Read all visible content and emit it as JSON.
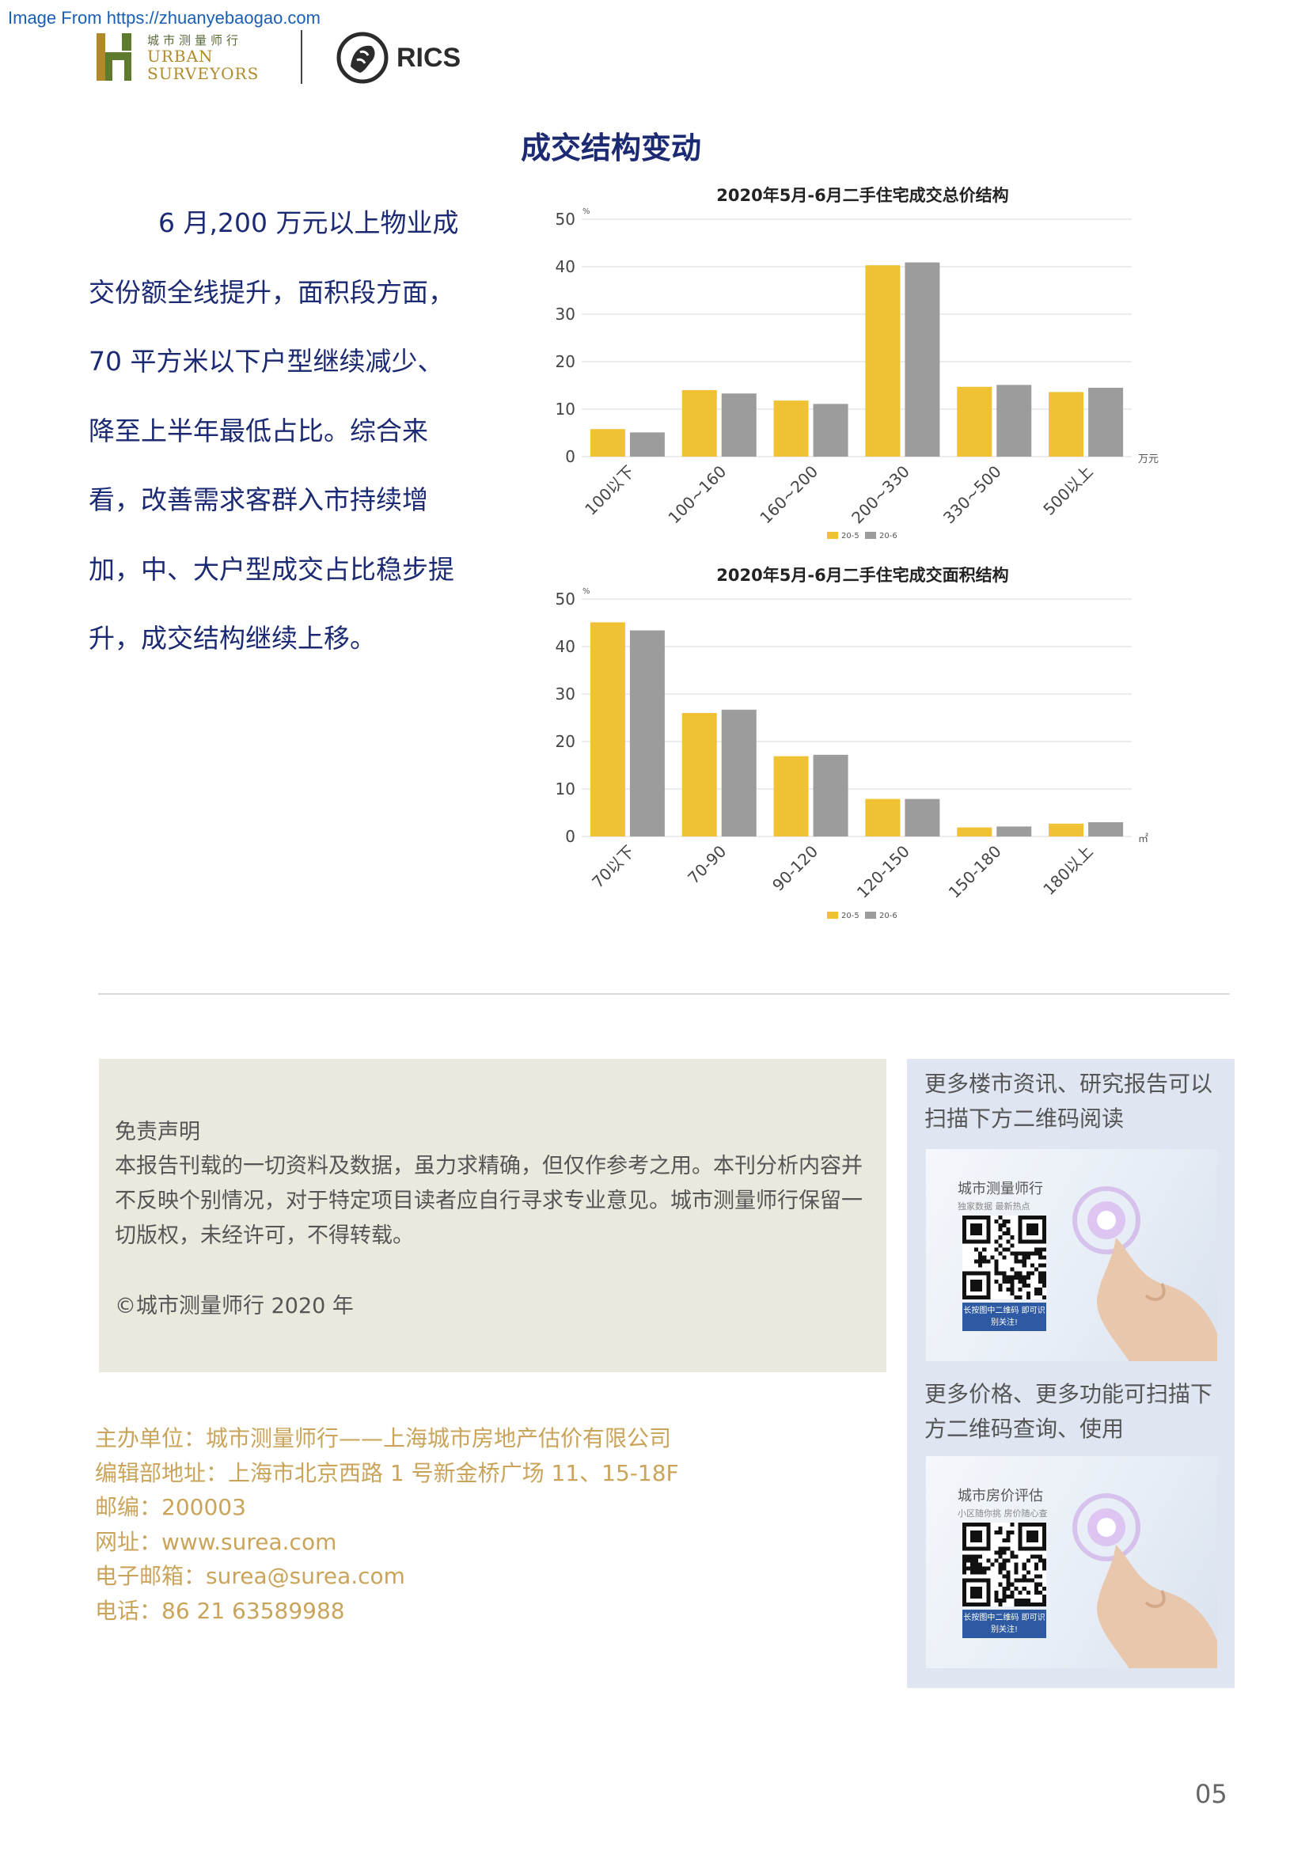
{
  "source_link": "Image From https://zhuanyebaogao.com",
  "header": {
    "logo_cn": "城市测量师行",
    "logo_en_line1": "URBAN",
    "logo_en_line2": "SURVEYORS",
    "rics": "RICS"
  },
  "page_title": "成交结构变动",
  "body_paragraph": "6 月,200 万元以上物业成交份额全线提升，面积段方面，70 平方米以下户型继续减少、降至上半年最低占比。综合来看，改善需求客群入市持续增加，中、大户型成交占比稳步提升，成交结构继续上移。",
  "body_lines": [
    "6 月,200 万元以上物业成",
    "交份额全线提升，面积段方面，",
    "70  平方米以下户型继续减少、",
    "降至上半年最低占比。综合来",
    "看，改善需求客群入市持续增",
    "加，中、大户型成交占比稳步提",
    "升，成交结构继续上移。"
  ],
  "chart_data": [
    {
      "type": "bar",
      "title": "2020年5月-6月二手住宅成交总价结构",
      "ylabel": "%",
      "xlabel": "万元",
      "ylim": [
        0,
        50
      ],
      "yticks": [
        0,
        10,
        20,
        30,
        40,
        50
      ],
      "categories": [
        "100以下",
        "100~160",
        "160~200",
        "200~330",
        "330~500",
        "500以上"
      ],
      "series": [
        {
          "name": "20-5",
          "color": "#f0c132",
          "values": [
            5.8,
            14.0,
            11.8,
            40.3,
            14.7,
            13.6
          ]
        },
        {
          "name": "20-6",
          "color": "#9c9c9c",
          "values": [
            5.1,
            13.3,
            11.1,
            40.9,
            15.1,
            14.5
          ]
        }
      ],
      "grid": true,
      "legend": "bottom"
    },
    {
      "type": "bar",
      "title": "2020年5月-6月二手住宅成交面积结构",
      "ylabel": "%",
      "xlabel": "㎡",
      "ylim": [
        0,
        50
      ],
      "yticks": [
        0,
        10,
        20,
        30,
        40,
        50
      ],
      "categories": [
        "70以下",
        "70-90",
        "90-120",
        "120-150",
        "150-180",
        "180以上"
      ],
      "series": [
        {
          "name": "20-5",
          "color": "#f0c132",
          "values": [
            45.1,
            26.0,
            16.9,
            7.9,
            1.9,
            2.7
          ]
        },
        {
          "name": "20-6",
          "color": "#9c9c9c",
          "values": [
            43.4,
            26.7,
            17.2,
            7.9,
            2.1,
            3.0
          ]
        }
      ],
      "grid": true,
      "legend": "bottom"
    }
  ],
  "disclaimer": {
    "title": "免责声明",
    "text": "本报告刊载的一切资料及数据，虽力求精确，但仅作参考之用。本刊分析内容并不反映个别情况，对于特定项目读者应自行寻求专业意见。城市测量师行保留一切版权，未经许可，不得转载。",
    "copyright": "©城市测量师行 2020 年"
  },
  "contact": {
    "organizer": "主办单位：城市测量师行——上海城市房地产估价有限公司",
    "address": "编辑部地址：上海市北京西路 1 号新金桥广场 11、15-18F",
    "postcode": "邮编：200003",
    "website": "网址：www.surea.com",
    "email": "电子邮箱：surea@surea.com",
    "phone": "电话：86 21 63589988"
  },
  "qr_panel": {
    "caption1": "更多楼市资讯、研究报告可以扫描下方二维码阅读",
    "card1_title": "城市测量师行",
    "card1_sub": "独家数据  最新热点",
    "caption2": "更多价格、更多功能可扫描下方二维码查询、使用",
    "card2_title": "城市房价评估",
    "card2_sub": "小区随你挑  房价随心查",
    "badge": "长按图中二维码 即可识别关注!"
  },
  "page_number": "05"
}
